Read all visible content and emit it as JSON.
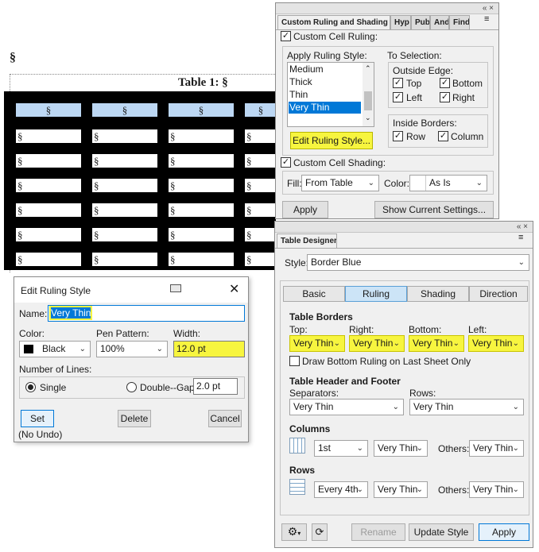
{
  "document": {
    "para_mark": "§",
    "table_title": "Table 1: §",
    "cell_mark": "§",
    "table_columns": 4,
    "table_body_rows": 6
  },
  "custom_ruling": {
    "panel_controls": "«  ×",
    "tabs": [
      "Custom Ruling and Shading",
      "Hyp",
      "Pub",
      "And",
      "Find"
    ],
    "menu_icon": "hamburger-icon",
    "custom_cell_ruling": {
      "label": "Custom Cell Ruling:",
      "checked": true
    },
    "apply_ruling_style": {
      "label": "Apply Ruling Style:",
      "items": [
        "Medium",
        "Thick",
        "Thin",
        "Very Thin"
      ],
      "selected": "Very Thin"
    },
    "edit_ruling_style_button": "Edit Ruling Style...",
    "to_selection": {
      "label": "To Selection:",
      "outside_edge": {
        "label": "Outside Edge:",
        "top": "Top",
        "bottom": "Bottom",
        "left": "Left",
        "right": "Right"
      },
      "inside_borders": {
        "label": "Inside Borders:",
        "row": "Row",
        "column": "Column"
      }
    },
    "custom_cell_shading": {
      "label": "Custom Cell Shading:",
      "checked": true
    },
    "fill": {
      "label": "Fill:",
      "value": "From Table"
    },
    "color": {
      "label": "Color:",
      "value": "As Is"
    },
    "apply_button": "Apply",
    "show_settings_button": "Show Current Settings..."
  },
  "table_designer": {
    "panel_controls": "«  ×",
    "tab": "Table Designer",
    "style": {
      "label": "Style:",
      "value": "Border Blue"
    },
    "tabs": [
      "Basic",
      "Ruling",
      "Shading",
      "Direction"
    ],
    "active_tab": "Ruling",
    "table_borders": {
      "heading": "Table Borders",
      "top": {
        "label": "Top:",
        "value": "Very Thin"
      },
      "right": {
        "label": "Right:",
        "value": "Very Thin"
      },
      "bottom": {
        "label": "Bottom:",
        "value": "Very Thin"
      },
      "left": {
        "label": "Left:",
        "value": "Very Thin"
      },
      "draw_bottom_label": "Draw Bottom Ruling on Last Sheet Only",
      "draw_bottom_checked": false
    },
    "header_footer": {
      "heading": "Table Header and Footer",
      "separators": {
        "label": "Separators:",
        "value": "Very Thin"
      },
      "rows": {
        "label": "Rows:",
        "value": "Very Thin"
      }
    },
    "columns": {
      "heading": "Columns",
      "which": "1st",
      "weight": "Very Thin",
      "others_label": "Others:",
      "others": "Very Thin"
    },
    "rows": {
      "heading": "Rows",
      "which": "Every 4th",
      "weight": "Very Thin",
      "others_label": "Others:",
      "others": "Very Thin"
    },
    "rename_button": "Rename",
    "update_style_button": "Update Style",
    "apply_button": "Apply"
  },
  "edit_ruling_dialog": {
    "title": "Edit Ruling Style",
    "name": {
      "label": "Name:",
      "value": "Very Thin"
    },
    "color": {
      "label": "Color:",
      "value": "Black",
      "swatch": "#000000"
    },
    "pen_pattern": {
      "label": "Pen Pattern:",
      "value": "100%"
    },
    "width": {
      "label": "Width:",
      "value": "12.0 pt"
    },
    "number_of_lines": {
      "label": "Number of Lines:",
      "single": "Single",
      "double": "Double--Gap:",
      "gap_value": "2.0 pt",
      "selected": "single"
    },
    "set_button": "Set",
    "delete_button": "Delete",
    "cancel_button": "Cancel",
    "note": "(No Undo)"
  },
  "colors": {
    "highlight": "#f7f53f",
    "selection": "#0078d7",
    "header_cell": "#bcd7f3"
  }
}
